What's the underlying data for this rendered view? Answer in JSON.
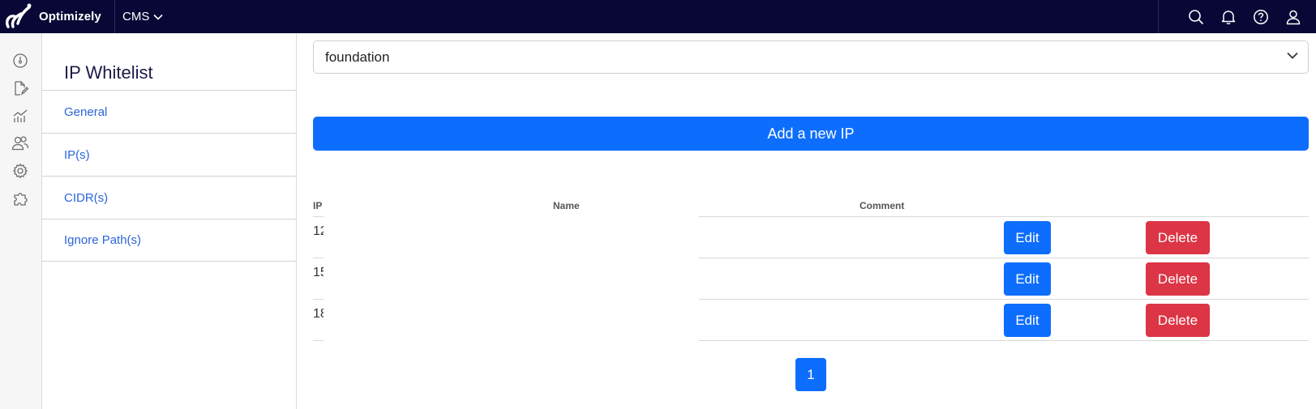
{
  "header": {
    "brand": "Optimizely",
    "product": "CMS",
    "icons": [
      "search-icon",
      "bell-icon",
      "help-icon",
      "user-icon"
    ]
  },
  "rail": {
    "icons": [
      "dashboard-icon",
      "content-edit-icon",
      "analytics-icon",
      "users-icon",
      "settings-icon",
      "addons-icon"
    ]
  },
  "subnav": {
    "title": "IP Whitelist",
    "items": [
      {
        "label": "General"
      },
      {
        "label": "IP(s)"
      },
      {
        "label": "CIDR(s)"
      },
      {
        "label": "Ignore Path(s)"
      }
    ]
  },
  "main": {
    "site_select": {
      "value": "foundation"
    },
    "add_button": "Add a new IP",
    "table": {
      "columns": [
        "IP",
        "Name",
        "Comment"
      ],
      "rows": [
        {
          "ip": "12",
          "edit": "Edit",
          "delete": "Delete"
        },
        {
          "ip": "15",
          "edit": "Edit",
          "delete": "Delete"
        },
        {
          "ip": "18",
          "edit": "Edit",
          "delete": "Delete"
        }
      ]
    },
    "pagination": {
      "current": "1"
    }
  },
  "colors": {
    "topbar": "#080736",
    "primary": "#0d6efd",
    "danger": "#dc3545",
    "link": "#2b64d9"
  }
}
